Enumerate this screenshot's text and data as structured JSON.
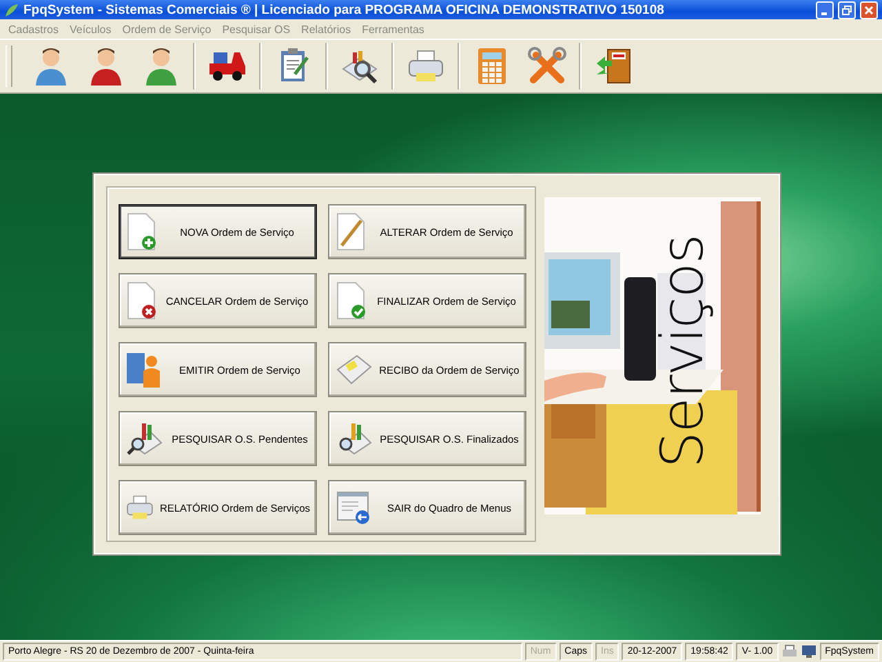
{
  "window": {
    "title": "FpqSystem - Sistemas Comerciais ®  | Licenciado para  PROGRAMA OFICINA DEMONSTRATIVO 150108"
  },
  "menu": [
    "Cadastros",
    "Veículos",
    "Ordem de Serviço",
    "Pesquisar OS",
    "Relatórios",
    "Ferramentas"
  ],
  "buttons": [
    {
      "label": "NOVA Ordem de Serviço",
      "focused": true
    },
    {
      "label": "ALTERAR Ordem de Serviço",
      "focused": false
    },
    {
      "label": "CANCELAR Ordem de Serviço",
      "focused": false
    },
    {
      "label": "FINALIZAR Ordem de Serviço",
      "focused": false
    },
    {
      "label": "EMITIR Ordem de Serviço",
      "focused": false
    },
    {
      "label": "RECIBO da Ordem de Serviço",
      "focused": false
    },
    {
      "label": "PESQUISAR O.S. Pendentes",
      "focused": false
    },
    {
      "label": "PESQUISAR O.S. Finalizados",
      "focused": false
    },
    {
      "label": "RELATÓRIO Ordem de Serviços",
      "focused": false
    },
    {
      "label": "SAIR do Quadro de Menus",
      "focused": false
    }
  ],
  "banner": {
    "kind": "picture",
    "title": "Serviços"
  },
  "status_bar": {
    "location": "Porto Alegre - RS 20 de Dezembro de 2007 - Quinta-feira",
    "keys": [
      {
        "label": "Num",
        "on": false
      },
      {
        "label": "Caps",
        "on": true
      },
      {
        "label": "Ins",
        "on": false
      }
    ],
    "date": "20-12-2007",
    "time": "19:58:42",
    "version": "V- 1.00",
    "app": "FpqSystem"
  }
}
